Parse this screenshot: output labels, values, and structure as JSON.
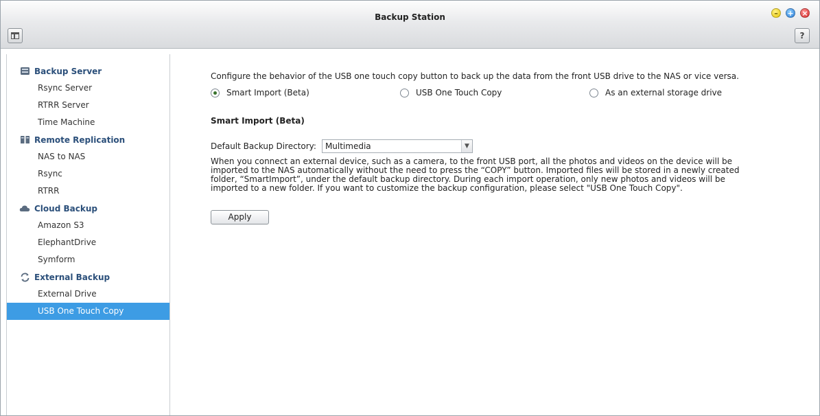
{
  "window": {
    "title": "Backup Station",
    "help_label": "?"
  },
  "sidebar": {
    "groups": [
      {
        "title": "Backup Server",
        "icon": "server-icon",
        "items": [
          "Rsync Server",
          "RTRR Server",
          "Time Machine"
        ]
      },
      {
        "title": "Remote Replication",
        "icon": "replication-icon",
        "items": [
          "NAS to NAS",
          "Rsync",
          "RTRR"
        ]
      },
      {
        "title": "Cloud Backup",
        "icon": "cloud-icon",
        "items": [
          "Amazon S3",
          "ElephantDrive",
          "Symform"
        ]
      },
      {
        "title": "External Backup",
        "icon": "sync-icon",
        "items": [
          "External Drive",
          "USB One Touch Copy"
        ]
      }
    ],
    "active_item": "USB One Touch Copy",
    "active_color": "#3d9ce4"
  },
  "main": {
    "description": "Configure the behavior of the USB one touch copy button to back up the data from the front USB drive to the NAS or vice versa.",
    "radio_options": [
      {
        "label": "Smart Import (Beta)",
        "checked": true
      },
      {
        "label": "USB One Touch Copy",
        "checked": false
      },
      {
        "label": "As an external storage drive",
        "checked": false
      }
    ],
    "section_title": "Smart Import (Beta)",
    "dir_label": "Default Backup Directory:",
    "dir_value": "Multimedia",
    "info_lines": [
      "When you connect an external device, such as a camera, to the front USB port, all the photos and videos on the device will be",
      "imported to the NAS automatically without the need to press the “COPY” button. Imported files will be stored in a newly created",
      "folder, “SmartImport”, under the default backup directory. During each import operation, only new photos and videos will be",
      "imported to a new folder. If you want to customize the backup configuration, please select \"USB One Touch Copy\"."
    ],
    "apply_label": "Apply"
  }
}
